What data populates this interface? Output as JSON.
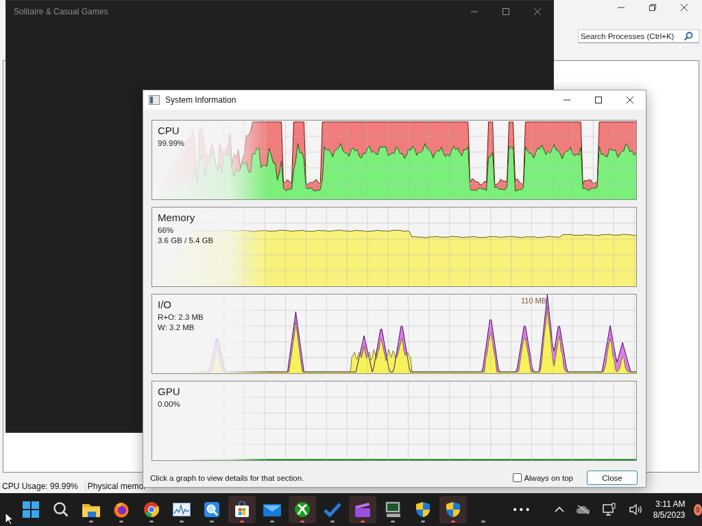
{
  "background_window": {
    "search": {
      "placeholder": "Search Processes (Ctrl+K)"
    },
    "status_bar": [
      "CPU Usage: 99.99%",
      "Physical memor"
    ]
  },
  "game_window": {
    "title": "Solitaire & Casual Games"
  },
  "dialog": {
    "title": "System Information",
    "graphs": [
      {
        "kind": "cpu",
        "label": "CPU",
        "readings": [
          "99.99%"
        ]
      },
      {
        "kind": "memory",
        "label": "Memory",
        "readings": [
          "66%",
          "3.6 GB / 5.4 GB"
        ]
      },
      {
        "kind": "io",
        "label": "I/O",
        "readings": [
          "R+O: 2.3 MB",
          "W: 3.2 MB"
        ],
        "peak_label": "110 MB"
      },
      {
        "kind": "gpu",
        "label": "GPU",
        "readings": [
          "0.00%"
        ]
      }
    ],
    "hint": "Click a graph to view details for that section.",
    "always_on_top": {
      "label": "Always on top",
      "checked": false
    },
    "close_button": "Close"
  },
  "taskbar": {
    "apps": [
      {
        "kind": "start",
        "running": false,
        "selected": false
      },
      {
        "kind": "search",
        "running": false,
        "selected": false
      },
      {
        "kind": "folder",
        "running": true,
        "selected": false
      },
      {
        "kind": "firefox",
        "running": true,
        "selected": false
      },
      {
        "kind": "chrome",
        "running": true,
        "selected": false
      },
      {
        "kind": "monitor",
        "running": true,
        "selected": false
      },
      {
        "kind": "magnifier",
        "running": true,
        "selected": false
      },
      {
        "kind": "store",
        "running": true,
        "selected": true
      },
      {
        "kind": "mail",
        "running": true,
        "selected": false
      },
      {
        "kind": "xbox",
        "running": true,
        "selected": true
      },
      {
        "kind": "check",
        "running": true,
        "selected": false
      },
      {
        "kind": "clapper",
        "running": true,
        "selected": true
      },
      {
        "kind": "computer",
        "running": true,
        "selected": false
      },
      {
        "kind": "shield",
        "running": true,
        "selected": false
      },
      {
        "kind": "shield",
        "running": true,
        "selected": true
      },
      {
        "kind": "blank",
        "running": true,
        "selected": false
      }
    ],
    "overflow": "•••",
    "clock": {
      "time": "3:11 AM",
      "date": "8/5/2023"
    },
    "notification_count": "9"
  }
}
